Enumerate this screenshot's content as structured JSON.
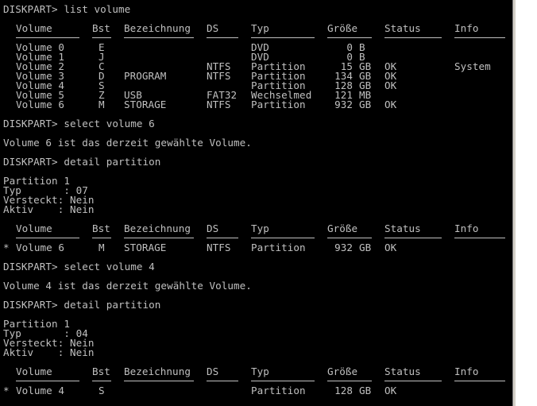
{
  "console": {
    "cmd_list_volume": "DISKPART> list volume",
    "headers": [
      "Volume",
      "Bst",
      "Bezeichnung",
      "DS",
      "Typ",
      "Größe",
      "Status",
      "Info"
    ],
    "volumes": [
      {
        "vol": "Volume 0",
        "bst": "E",
        "bez": "",
        "ds": "",
        "typ": "DVD",
        "size_num": "0",
        "size_unit": "B",
        "status": "",
        "info": ""
      },
      {
        "vol": "Volume 1",
        "bst": "J",
        "bez": "",
        "ds": "",
        "typ": "DVD",
        "size_num": "0",
        "size_unit": "B",
        "status": "",
        "info": ""
      },
      {
        "vol": "Volume 2",
        "bst": "C",
        "bez": "",
        "ds": "NTFS",
        "typ": "Partition",
        "size_num": "15",
        "size_unit": "GB",
        "status": "OK",
        "info": "System"
      },
      {
        "vol": "Volume 3",
        "bst": "D",
        "bez": "PROGRAM",
        "ds": "NTFS",
        "typ": "Partition",
        "size_num": "134",
        "size_unit": "GB",
        "status": "OK",
        "info": ""
      },
      {
        "vol": "Volume 4",
        "bst": "S",
        "bez": "",
        "ds": "",
        "typ": "Partition",
        "size_num": "128",
        "size_unit": "GB",
        "status": "OK",
        "info": ""
      },
      {
        "vol": "Volume 5",
        "bst": "Z",
        "bez": "USB",
        "ds": "FAT32",
        "typ": "Wechselmed",
        "size_num": "121",
        "size_unit": "MB",
        "status": "",
        "info": ""
      },
      {
        "vol": "Volume 6",
        "bst": "M",
        "bez": "STORAGE",
        "ds": "NTFS",
        "typ": "Partition",
        "size_num": "932",
        "size_unit": "GB",
        "status": "OK",
        "info": ""
      }
    ],
    "cmd_select_6": "DISKPART> select volume 6",
    "msg_selected_6": "Volume 6 ist das derzeit gewählte Volume.",
    "cmd_detail_1": "DISKPART> detail partition",
    "detail1": {
      "partition": "Partition 1",
      "typ": "Typ       : 07",
      "versteckt": "Versteckt: Nein",
      "aktiv": "Aktiv    : Nein",
      "row": {
        "star": "*",
        "vol": "Volume 6",
        "bst": "M",
        "bez": "STORAGE",
        "ds": "NTFS",
        "typ": "Partition",
        "size_num": "932",
        "size_unit": "GB",
        "status": "OK",
        "info": ""
      }
    },
    "cmd_select_4": "DISKPART> select volume 4",
    "msg_selected_4": "Volume 4 ist das derzeit gewählte Volume.",
    "cmd_detail_2": "DISKPART> detail partition",
    "detail2": {
      "partition": "Partition 1",
      "typ": "Typ       : 04",
      "versteckt": "Versteckt: Nein",
      "aktiv": "Aktiv    : Nein",
      "row": {
        "star": "*",
        "vol": "Volume 4",
        "bst": "S",
        "bez": "",
        "ds": "",
        "typ": "Partition",
        "size_num": "128",
        "size_unit": "GB",
        "status": "OK",
        "info": ""
      }
    }
  },
  "colors": {
    "background": "#000000",
    "text": "#c0c0c0"
  }
}
